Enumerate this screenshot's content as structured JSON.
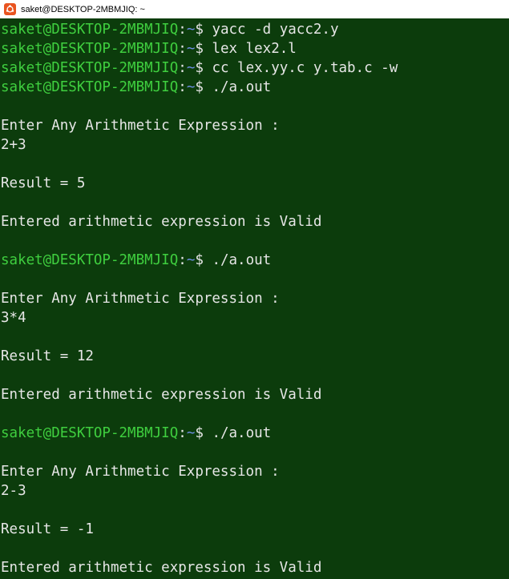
{
  "window": {
    "title": "saket@DESKTOP-2MBMJIQ: ~",
    "icon": "ubuntu-icon",
    "colors": {
      "terminal_bg": "#0c3c0c",
      "prompt_user": "#3fcf3f",
      "prompt_path": "#6f8fe8",
      "text": "#e6e6e6",
      "icon_bg": "#e95420"
    }
  },
  "prompt": {
    "user_host": "saket@DESKTOP-2MBMJIQ",
    "separator": ":",
    "path": "~",
    "symbol": "$ "
  },
  "lines": [
    {
      "type": "prompt",
      "command": "yacc -d yacc2.y"
    },
    {
      "type": "prompt",
      "command": "lex lex2.l"
    },
    {
      "type": "prompt",
      "command": "cc lex.yy.c y.tab.c -w"
    },
    {
      "type": "prompt",
      "command": "./a.out"
    },
    {
      "type": "blank",
      "text": ""
    },
    {
      "type": "output",
      "text": "Enter Any Arithmetic Expression :"
    },
    {
      "type": "output",
      "text": "2+3"
    },
    {
      "type": "blank",
      "text": ""
    },
    {
      "type": "output",
      "text": "Result = 5"
    },
    {
      "type": "blank",
      "text": ""
    },
    {
      "type": "output",
      "text": "Entered arithmetic expression is Valid"
    },
    {
      "type": "blank",
      "text": ""
    },
    {
      "type": "prompt",
      "command": "./a.out"
    },
    {
      "type": "blank",
      "text": ""
    },
    {
      "type": "output",
      "text": "Enter Any Arithmetic Expression :"
    },
    {
      "type": "output",
      "text": "3*4"
    },
    {
      "type": "blank",
      "text": ""
    },
    {
      "type": "output",
      "text": "Result = 12"
    },
    {
      "type": "blank",
      "text": ""
    },
    {
      "type": "output",
      "text": "Entered arithmetic expression is Valid"
    },
    {
      "type": "blank",
      "text": ""
    },
    {
      "type": "prompt",
      "command": "./a.out"
    },
    {
      "type": "blank",
      "text": ""
    },
    {
      "type": "output",
      "text": "Enter Any Arithmetic Expression :"
    },
    {
      "type": "output",
      "text": "2-3"
    },
    {
      "type": "blank",
      "text": ""
    },
    {
      "type": "output",
      "text": "Result = -1"
    },
    {
      "type": "blank",
      "text": ""
    },
    {
      "type": "output",
      "text": "Entered arithmetic expression is Valid"
    }
  ]
}
